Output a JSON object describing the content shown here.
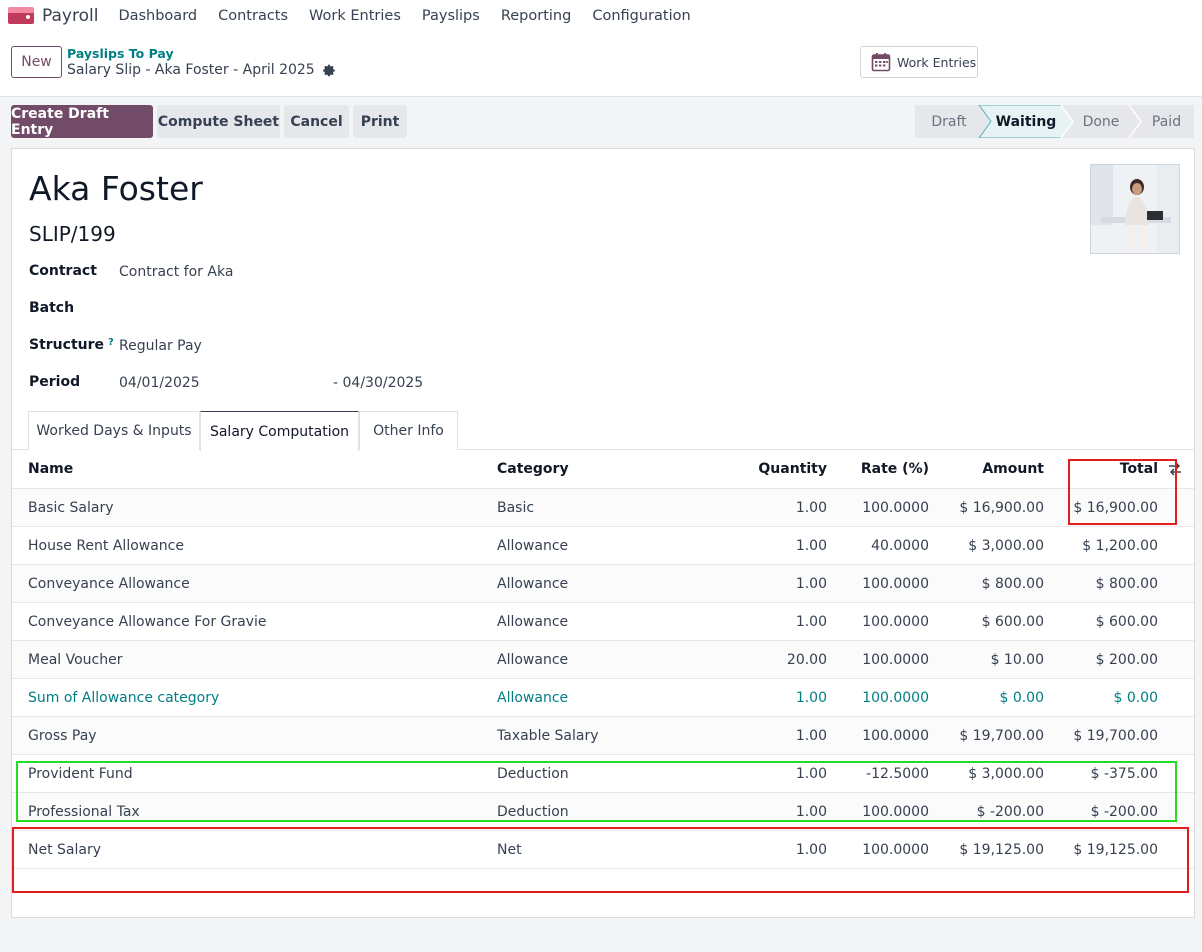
{
  "navbar": {
    "app_name": "Payroll",
    "menu": [
      "Dashboard",
      "Contracts",
      "Work Entries",
      "Payslips",
      "Reporting",
      "Configuration"
    ]
  },
  "control_panel": {
    "new_label": "New",
    "breadcrumb_parent": "Payslips To Pay",
    "breadcrumb_current": "Salary Slip - Aka Foster - April 2025",
    "work_entries_label": "Work Entries"
  },
  "actions": {
    "create_draft": "Create Draft Entry",
    "compute_sheet": "Compute Sheet",
    "cancel": "Cancel",
    "print": "Print"
  },
  "stages": {
    "items": [
      "Draft",
      "Waiting",
      "Done",
      "Paid"
    ],
    "active": "Waiting"
  },
  "form": {
    "employee_name": "Aka Foster",
    "reference": "SLIP/199",
    "contract_label": "Contract",
    "contract_value": "Contract for Aka",
    "batch_label": "Batch",
    "structure_label": "Structure",
    "structure_help": "?",
    "structure_value": "Regular Pay",
    "period_label": "Period",
    "period_from": "04/01/2025",
    "period_to": "- 04/30/2025"
  },
  "tabs": [
    "Worked Days & Inputs",
    "Salary Computation",
    "Other Info"
  ],
  "active_tab": "Salary Computation",
  "table": {
    "headers": {
      "name": "Name",
      "category": "Category",
      "quantity": "Quantity",
      "rate": "Rate (%)",
      "amount": "Amount",
      "total": "Total"
    },
    "rows": [
      {
        "name": "Basic Salary",
        "category": "Basic",
        "quantity": "1.00",
        "rate": "100.0000",
        "amount": "$ 16,900.00",
        "total": "$ 16,900.00"
      },
      {
        "name": "House Rent Allowance",
        "category": "Allowance",
        "quantity": "1.00",
        "rate": "40.0000",
        "amount": "$ 3,000.00",
        "total": "$ 1,200.00"
      },
      {
        "name": "Conveyance Allowance",
        "category": "Allowance",
        "quantity": "1.00",
        "rate": "100.0000",
        "amount": "$ 800.00",
        "total": "$ 800.00"
      },
      {
        "name": "Conveyance Allowance For Gravie",
        "category": "Allowance",
        "quantity": "1.00",
        "rate": "100.0000",
        "amount": "$ 600.00",
        "total": "$ 600.00"
      },
      {
        "name": "Meal Voucher",
        "category": "Allowance",
        "quantity": "20.00",
        "rate": "100.0000",
        "amount": "$ 10.00",
        "total": "$ 200.00"
      },
      {
        "name": "Sum of Allowance category",
        "category": "Allowance",
        "quantity": "1.00",
        "rate": "100.0000",
        "amount": "$ 0.00",
        "total": "$ 0.00"
      },
      {
        "name": "Gross Pay",
        "category": "Taxable Salary",
        "quantity": "1.00",
        "rate": "100.0000",
        "amount": "$ 19,700.00",
        "total": "$ 19,700.00"
      },
      {
        "name": "Provident Fund",
        "category": "Deduction",
        "quantity": "1.00",
        "rate": "-12.5000",
        "amount": "$ 3,000.00",
        "total": "$ -375.00"
      },
      {
        "name": "Professional Tax",
        "category": "Deduction",
        "quantity": "1.00",
        "rate": "100.0000",
        "amount": "$ -200.00",
        "total": "$ -200.00"
      },
      {
        "name": "Net Salary",
        "category": "Net",
        "quantity": "1.00",
        "rate": "100.0000",
        "amount": "$ 19,125.00",
        "total": "$ 19,125.00"
      }
    ]
  },
  "colors": {
    "brand": "#714b67",
    "link": "#017e84",
    "annotation_red": "#e11d1d",
    "annotation_green": "#22dd22"
  }
}
